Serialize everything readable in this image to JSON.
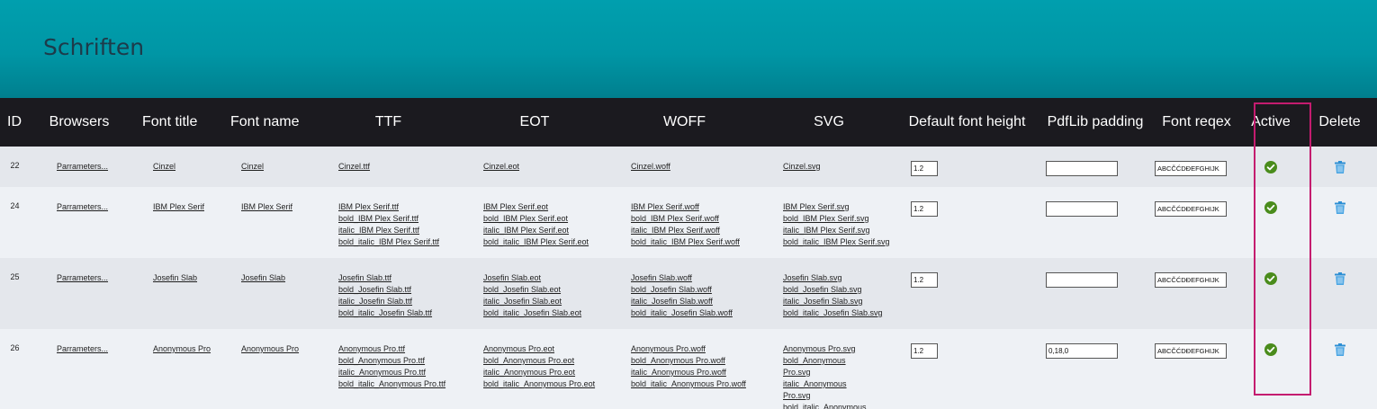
{
  "page": {
    "title": "Schriften"
  },
  "table": {
    "headers": {
      "id": "ID",
      "browsers": "Browsers",
      "font_title": "Font title",
      "font_name": "Font name",
      "ttf": "TTF",
      "eot": "EOT",
      "woff": "WOFF",
      "svg": "SVG",
      "default_font_height": "Default font height",
      "pdflib_padding": "PdfLib padding",
      "font_regex": "Font reqex",
      "active": "Active",
      "delete": "Delete"
    },
    "rows": [
      {
        "id": "22",
        "browsers": "Parrameters...",
        "font_title": "Cinzel",
        "font_name": "Cinzel",
        "ttf": [
          "Cinzel.ttf"
        ],
        "eot": [
          "Cinzel.eot"
        ],
        "woff": [
          "Cinzel.woff"
        ],
        "svg": [
          "Cinzel.svg"
        ],
        "default_font_height": "1.2",
        "pdflib_padding": "",
        "font_regex": "ABCČĆDĐEFGHIJK",
        "active": true,
        "active_icon": "check-circle-icon",
        "delete_icon": "trash-icon"
      },
      {
        "id": "24",
        "browsers": "Parrameters...",
        "font_title": "IBM Plex Serif",
        "font_name": "IBM Plex Serif",
        "ttf": [
          "IBM Plex Serif.ttf",
          "bold_IBM Plex Serif.ttf",
          "italic_IBM Plex Serif.ttf",
          "bold_italic_IBM Plex Serif.ttf"
        ],
        "eot": [
          "IBM Plex Serif.eot",
          "bold_IBM Plex Serif.eot",
          "italic_IBM Plex Serif.eot",
          "bold_italic_IBM Plex Serif.eot"
        ],
        "woff": [
          "IBM Plex Serif.woff",
          "bold_IBM Plex Serif.woff",
          "italic_IBM Plex Serif.woff",
          "bold_italic_IBM Plex Serif.woff"
        ],
        "svg": [
          "IBM Plex Serif.svg",
          "bold_IBM Plex Serif.svg",
          "italic_IBM Plex Serif.svg",
          "bold_italic_IBM Plex Serif.svg"
        ],
        "default_font_height": "1.2",
        "pdflib_padding": "",
        "font_regex": "ABCČĆDĐEFGHIJK",
        "active": true,
        "active_icon": "check-circle-icon",
        "delete_icon": "trash-icon"
      },
      {
        "id": "25",
        "browsers": "Parrameters...",
        "font_title": "Josefin Slab",
        "font_name": "Josefin Slab",
        "ttf": [
          "Josefin Slab.ttf",
          "bold_Josefin Slab.ttf",
          "italic_Josefin Slab.ttf",
          "bold_italic_Josefin Slab.ttf"
        ],
        "eot": [
          "Josefin Slab.eot",
          "bold_Josefin Slab.eot",
          "italic_Josefin Slab.eot",
          "bold_italic_Josefin Slab.eot"
        ],
        "woff": [
          "Josefin Slab.woff",
          "bold_Josefin Slab.woff",
          "italic_Josefin Slab.woff",
          "bold_italic_Josefin Slab.woff"
        ],
        "svg": [
          "Josefin Slab.svg",
          "bold_Josefin Slab.svg",
          "italic_Josefin Slab.svg",
          "bold_italic_Josefin Slab.svg"
        ],
        "default_font_height": "1.2",
        "pdflib_padding": "",
        "font_regex": "ABCČĆDĐEFGHIJK",
        "active": true,
        "active_icon": "check-circle-icon",
        "delete_icon": "trash-icon"
      },
      {
        "id": "26",
        "browsers": "Parrameters...",
        "font_title": "Anonymous Pro",
        "font_name": "Anonymous Pro",
        "ttf": [
          "Anonymous Pro.ttf",
          "bold_Anonymous Pro.ttf",
          "italic_Anonymous Pro.ttf",
          "bold_italic_Anonymous Pro.ttf"
        ],
        "eot": [
          "Anonymous Pro.eot",
          "bold_Anonymous Pro.eot",
          "italic_Anonymous Pro.eot",
          "bold_italic_Anonymous Pro.eot"
        ],
        "woff": [
          "Anonymous Pro.woff",
          "bold_Anonymous Pro.woff",
          "italic_Anonymous Pro.woff",
          "bold_italic_Anonymous Pro.woff"
        ],
        "svg": [
          "Anonymous Pro.svg",
          "bold_Anonymous Pro.svg",
          "italic_Anonymous Pro.svg",
          "bold_italic_Anonymous Pro.svg"
        ],
        "default_font_height": "1.2",
        "pdflib_padding": "0,18,0",
        "font_regex": "ABCČĆDĐEFGHIJK",
        "active": true,
        "active_icon": "check-circle-icon",
        "delete_icon": "trash-icon"
      }
    ]
  },
  "colors": {
    "banner": "#009fae",
    "header_bg": "#1b1a1f",
    "active_green": "#4a8c1c",
    "delete_blue": "#2d8fd4",
    "highlight": "#c41c6f"
  }
}
